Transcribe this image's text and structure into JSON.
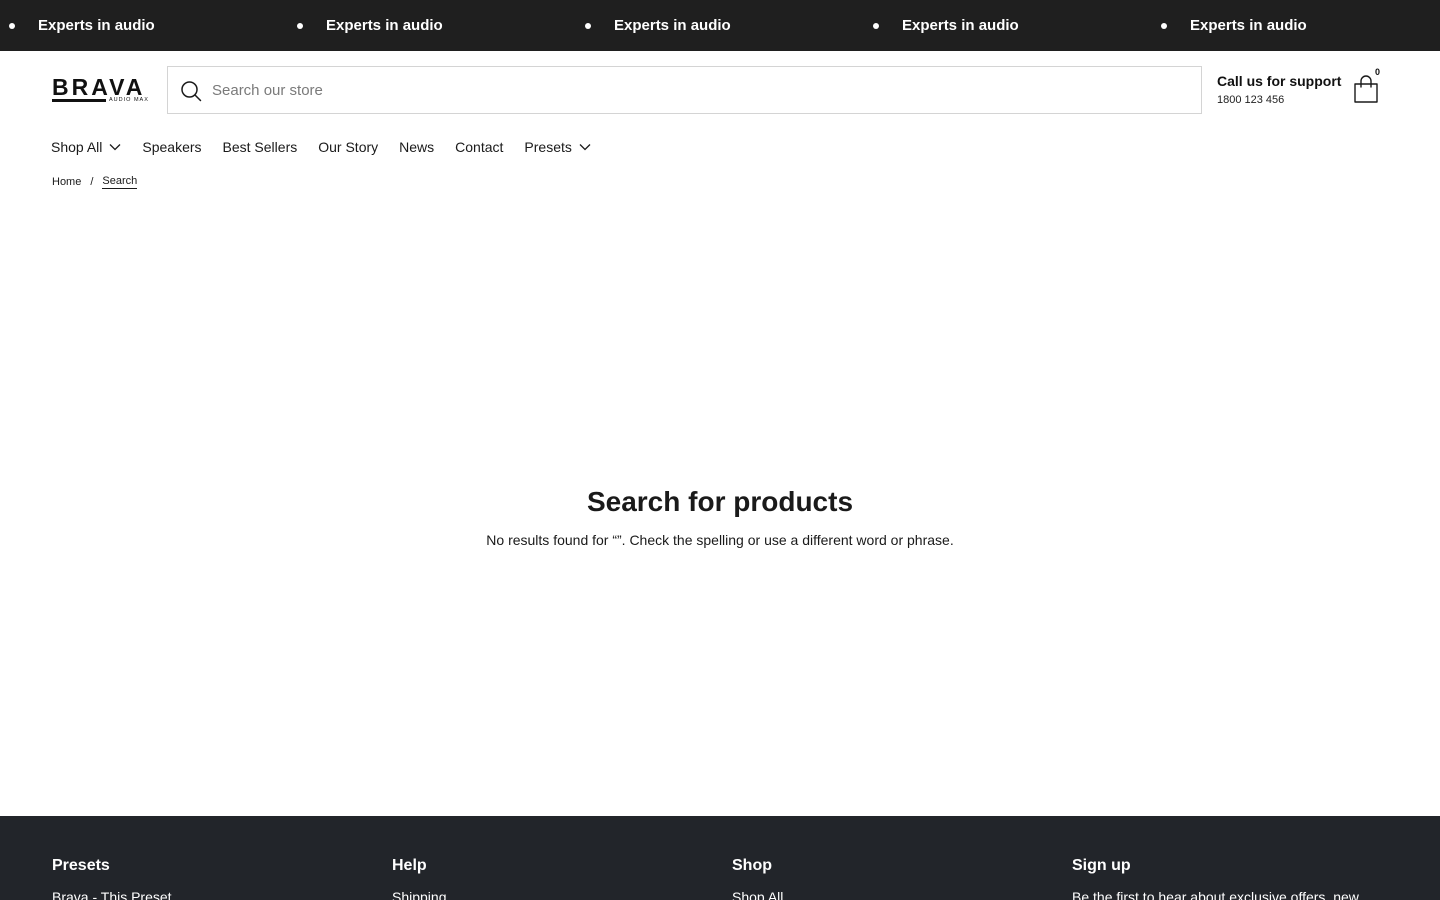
{
  "announcement": {
    "items": [
      "Experts in audio",
      "Experts in audio",
      "Experts in audio",
      "Experts in audio",
      "Experts in audio"
    ]
  },
  "header": {
    "logo": {
      "word": "BRAVA",
      "sub": "AUDIO MAX"
    },
    "search": {
      "placeholder": "Search our store",
      "value": ""
    },
    "support": {
      "title": "Call us for support",
      "phone": "1800 123 456"
    },
    "cart": {
      "count": "0"
    }
  },
  "nav": {
    "items": [
      {
        "label": "Shop All",
        "dropdown": true
      },
      {
        "label": "Speakers",
        "dropdown": false
      },
      {
        "label": "Best Sellers",
        "dropdown": false
      },
      {
        "label": "Our Story",
        "dropdown": false
      },
      {
        "label": "News",
        "dropdown": false
      },
      {
        "label": "Contact",
        "dropdown": false
      },
      {
        "label": "Presets",
        "dropdown": true
      }
    ]
  },
  "breadcrumb": {
    "home": "Home",
    "separator": "/",
    "current": "Search"
  },
  "main": {
    "title": "Search for products",
    "message": "No results found for “”. Check the spelling or use a different word or phrase."
  },
  "footer": {
    "columns": [
      {
        "title": "Presets",
        "link": "Brava - This Preset"
      },
      {
        "title": "Help",
        "link": "Shipping"
      },
      {
        "title": "Shop",
        "link": "Shop All"
      },
      {
        "title": "Sign up",
        "text": "Be the first to hear about exclusive offers, new"
      }
    ]
  },
  "colors": {
    "announcement_bg": "#1f1f1f",
    "footer_bg": "#22252a",
    "text": "#1a1a1a"
  }
}
